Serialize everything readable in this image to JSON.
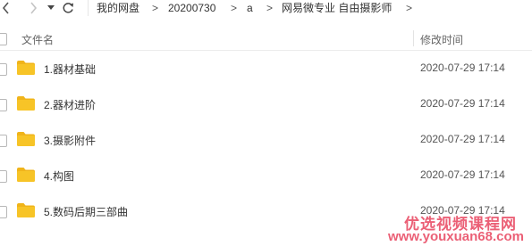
{
  "toolbar": {
    "back_icon": "chevron-left-icon",
    "forward_icon": "chevron-right-icon",
    "dropdown_icon": "caret-down-icon",
    "refresh_icon": "refresh-icon",
    "breadcrumbs": [
      "我的网盘",
      "20200730",
      "a",
      "网易微专业 自由摄影师"
    ],
    "separator": ">"
  },
  "list_header": {
    "name": "文件名",
    "modified": "修改时间"
  },
  "files": [
    {
      "name": "1.器材基础",
      "modified": "2020-07-29 17:14",
      "icon": "folder-icon"
    },
    {
      "name": "2.器材进阶",
      "modified": "2020-07-29 17:14",
      "icon": "folder-icon"
    },
    {
      "name": "3.摄影附件",
      "modified": "2020-07-29 17:14",
      "icon": "folder-icon"
    },
    {
      "name": "4.构图",
      "modified": "2020-07-29 17:14",
      "icon": "folder-icon"
    },
    {
      "name": "5.数码后期三部曲",
      "modified": "2020-07-29 17:14",
      "icon": "folder-icon"
    }
  ],
  "watermark": {
    "title": "优选视频课程网",
    "url": "www.youxuan68.com"
  },
  "colors": {
    "folder": "#f7c427",
    "folder_tab": "#f0b41a",
    "watermark": "#e8455f"
  }
}
